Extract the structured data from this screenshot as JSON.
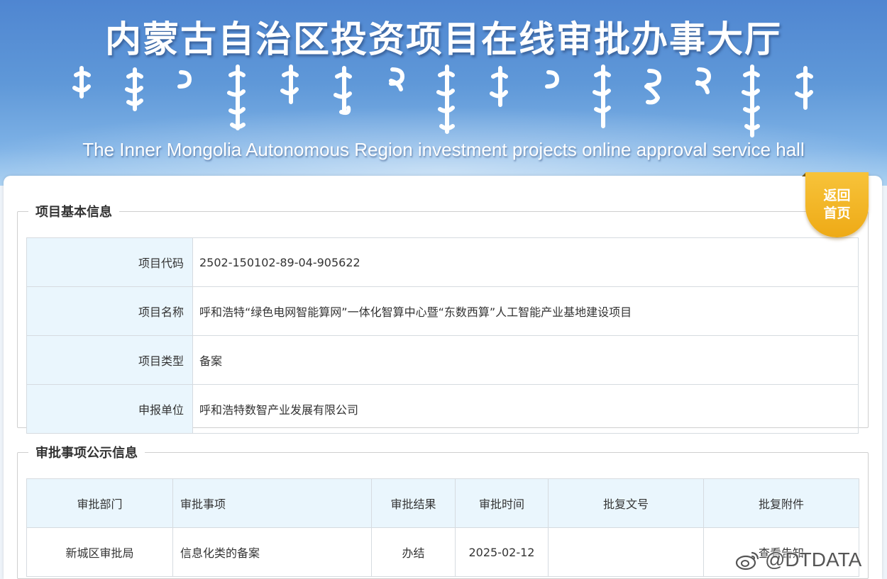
{
  "header": {
    "title_cn": "内蒙古自治区投资项目在线审批办事大厅",
    "title_en": "The Inner Mongolia Autonomous Region investment projects online approval service hall",
    "script_icon": "mongolian-script-title"
  },
  "back_button": {
    "line1": "返回",
    "line2": "首页"
  },
  "basic_info": {
    "legend": "项目基本信息",
    "rows": [
      {
        "label": "项目代码",
        "value": "2502-150102-89-04-905622"
      },
      {
        "label": "项目名称",
        "value": "呼和浩特“绿色电网智能算网”一体化智算中心暨“东数西算”人工智能产业基地建设项目"
      },
      {
        "label": "项目类型",
        "value": "备案"
      },
      {
        "label": "申报单位",
        "value": "呼和浩特数智产业发展有限公司"
      }
    ]
  },
  "approval_info": {
    "legend": "审批事项公示信息",
    "columns": [
      "审批部门",
      "审批事项",
      "审批结果",
      "审批时间",
      "批复文号",
      "批复附件"
    ],
    "rows": [
      [
        "新城区审批局",
        "信息化类的备案",
        "办结",
        "2025-02-12",
        "",
        "查看告知"
      ]
    ]
  },
  "watermark": {
    "text": "@DTDATA",
    "icon": "weibo-icon"
  },
  "colors": {
    "accent": "#f0ae1a",
    "header_bg": "#5a93d6",
    "label_bg": "#eaf6fd"
  }
}
